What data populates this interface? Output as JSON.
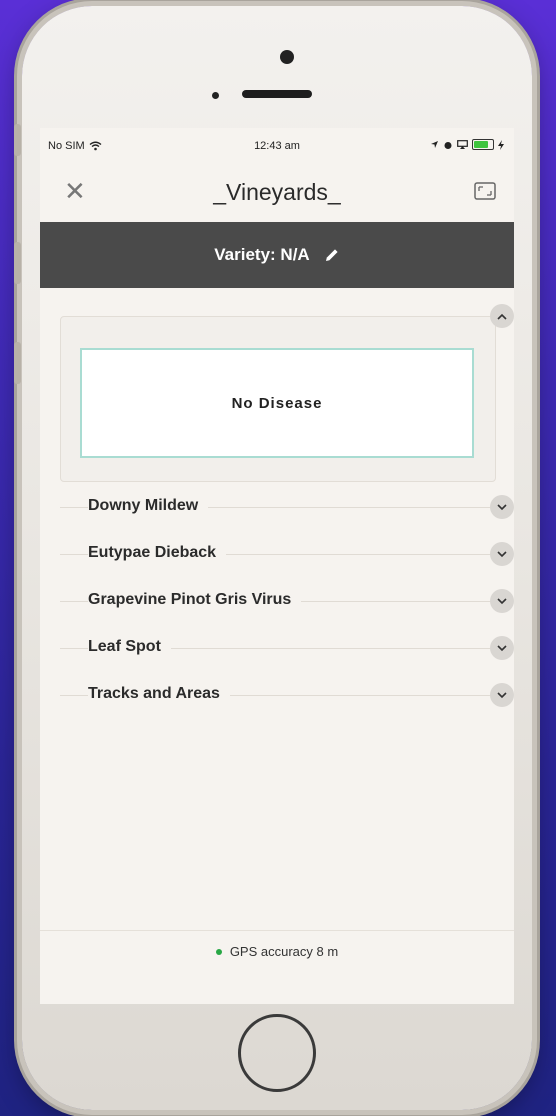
{
  "status_bar": {
    "carrier": "No SIM",
    "time": "12:43 am"
  },
  "nav": {
    "title": "_Vineyards_"
  },
  "variety": {
    "label": "Variety: N/A"
  },
  "selected_card": {
    "label": "No Disease"
  },
  "disease_rows": [
    {
      "label": "Downy Mildew"
    },
    {
      "label": "Eutypae Dieback"
    },
    {
      "label": "Grapevine Pinot Gris Virus"
    },
    {
      "label": "Leaf Spot"
    },
    {
      "label": "Tracks and Areas"
    }
  ],
  "footer": {
    "gps_text": "GPS accuracy 8 m"
  },
  "colors": {
    "variety_bar": "#4a4a4a",
    "selected_border": "#a9dcd2",
    "gps_dot": "#28a745"
  }
}
